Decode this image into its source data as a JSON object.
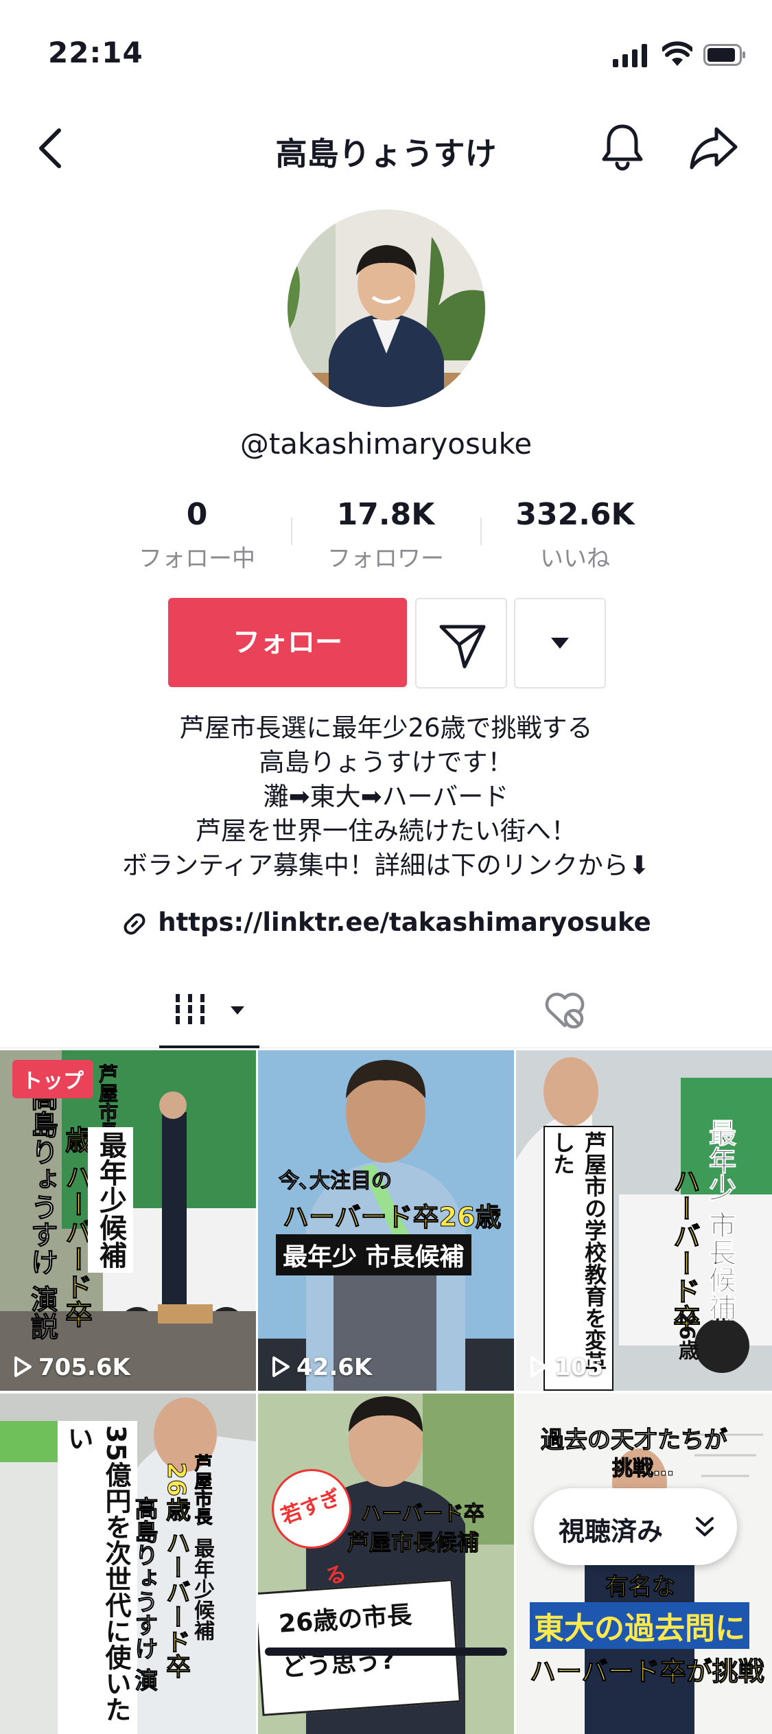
{
  "status_bar": {
    "time": "22:14"
  },
  "nav": {
    "title": "高島りょうすけ"
  },
  "profile": {
    "handle": "@takashimaryosuke",
    "stats": [
      {
        "value": "0",
        "label": "フォロー中"
      },
      {
        "value": "17.8K",
        "label": "フォロワー"
      },
      {
        "value": "332.6K",
        "label": "いいね"
      }
    ],
    "follow_label": "フォロー",
    "bio_lines": [
      "芦屋市長選に最年少26歳で挑戦する",
      "高島りょうすけです！",
      "灘➡東大➡ハーバード",
      "芦屋を世界一住み続けたい街へ！",
      "ボランティア募集中！詳細は下のリンクから⬇"
    ],
    "link": "https://linktr.ee/takashimaryosuke"
  },
  "videos": [
    {
      "views": "705.6K",
      "badge": "トップ",
      "overlay_text": [
        "芦屋市長",
        "最年少候補",
        "歳 ハーバード卒",
        "高島りょうすけ 演説"
      ]
    },
    {
      "views": "42.6K",
      "overlay_text": [
        "今､大注目の",
        "ハーバード卒26歳",
        "最年少 市長候補"
      ]
    },
    {
      "views": "105",
      "overlay_text": [
        "芦屋市の学校教育を変革した",
        "最年少 市長候補",
        "ハーバード卒",
        "26歳"
      ]
    },
    {
      "views": "",
      "overlay_text": [
        "35億円を次世代に使いたい",
        "芦屋市長",
        "26歳 ハーバード卒",
        "最年少候補",
        "高島りょうすけ 演"
      ]
    },
    {
      "views": "",
      "overlay_text": [
        "若すぎる",
        "ハーバード卒",
        "芦屋市長候補",
        "26歳の市長",
        "どう思う?"
      ]
    },
    {
      "views": "",
      "overlay_text": [
        "過去の天才たちが",
        "挑戦…",
        "有名な",
        "東大の過去問に",
        "ハーバード卒が挑戦"
      ]
    }
  ],
  "watched_pill": {
    "label": "視聴済み"
  },
  "colors": {
    "accent": "#ea4359",
    "text": "#161823",
    "secondary": "#8a8b91"
  }
}
